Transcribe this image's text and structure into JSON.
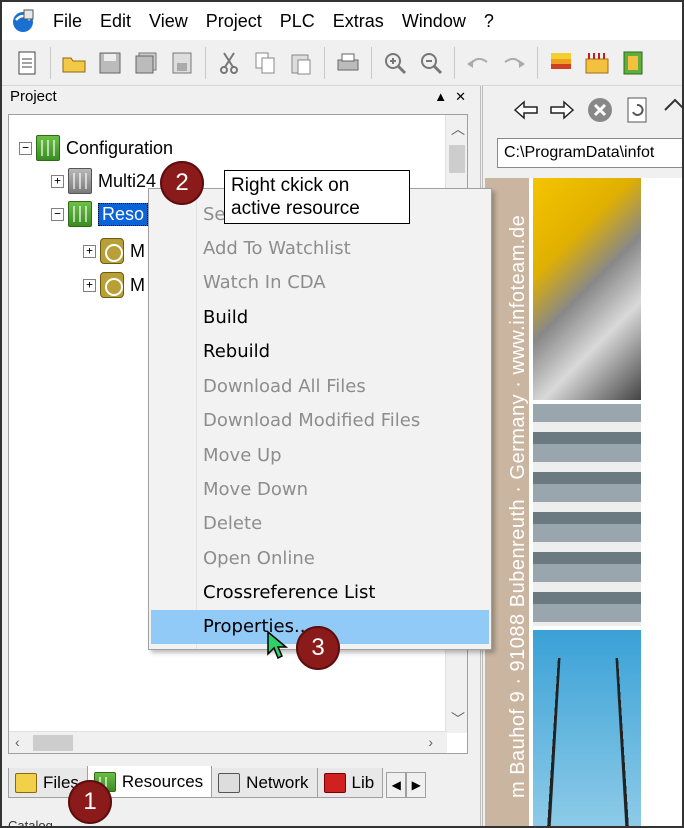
{
  "menubar": {
    "items": [
      "File",
      "Edit",
      "View",
      "Project",
      "PLC",
      "Extras",
      "Window",
      "?"
    ]
  },
  "toolbar": {
    "buttons": [
      "new-icon",
      "open-folder-icon",
      "save-icon",
      "save-all-icon",
      "save-as-icon",
      "cut-icon",
      "copy-icon",
      "paste-icon",
      "print-icon",
      "zoom-in-icon",
      "zoom-out-icon",
      "undo-icon",
      "redo-icon",
      "stack-icon",
      "plc-icon",
      "resource-icon"
    ]
  },
  "project_panel": {
    "title": "Project",
    "controls": [
      "▲",
      "✕"
    ],
    "tree": {
      "root": "Configuration",
      "multi": "Multi24",
      "resource": "Reso",
      "task1": "M",
      "task2": "M"
    },
    "tabs": [
      {
        "label": "Files",
        "active": false
      },
      {
        "label": "Resources",
        "active": true
      },
      {
        "label": "Network",
        "active": false
      },
      {
        "label": "Lib",
        "active": false
      }
    ],
    "catalog_label": "Catalog"
  },
  "context_menu": {
    "items": [
      {
        "label": "Set",
        "enabled": false
      },
      {
        "label": "Add To Watchlist",
        "enabled": false
      },
      {
        "label": "Watch In CDA",
        "enabled": false
      },
      {
        "label": "Build",
        "enabled": true
      },
      {
        "label": "Rebuild",
        "enabled": true
      },
      {
        "label": "Download All Files",
        "enabled": false
      },
      {
        "label": "Download Modified Files",
        "enabled": false
      },
      {
        "label": "Move Up",
        "enabled": false
      },
      {
        "label": "Move Down",
        "enabled": false
      },
      {
        "label": "Delete",
        "enabled": false
      },
      {
        "label": "Open Online",
        "enabled": false
      },
      {
        "label": "Crossreference List",
        "enabled": true
      },
      {
        "label": "Properties...",
        "enabled": true,
        "highlighted": true
      }
    ]
  },
  "callouts": {
    "note": "Right ckick on active resource",
    "badge1": "1",
    "badge2": "2",
    "badge3": "3"
  },
  "right_pane": {
    "path": "C:\\ProgramData\\infot",
    "banner_text": "m Bauhof 9 · 91088 Bubenreuth · Germany · www.infoteam.de",
    "nav_buttons": [
      "back-arrow-icon",
      "forward-arrow-icon",
      "stop-icon",
      "refresh-icon",
      "home-icon"
    ]
  },
  "colors": {
    "selection": "#0a64d8",
    "menu_highlight": "#91c9f7",
    "badge": "#8b1b1b",
    "disabled_text": "#8d8d8d"
  }
}
